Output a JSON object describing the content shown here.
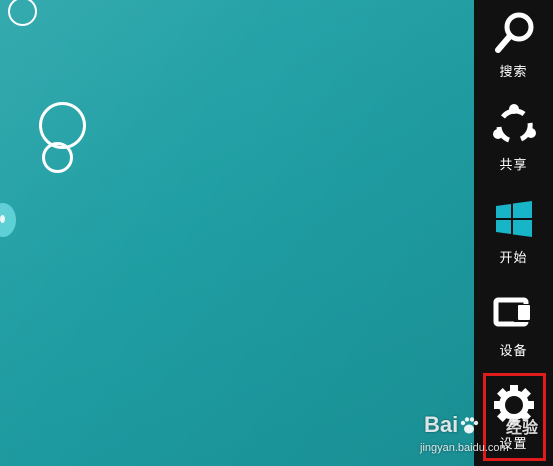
{
  "colors": {
    "desktop_background": "#1f9ea3",
    "charms_bar": "#111111",
    "start_tile": "#18b4c8",
    "highlight": "#e01b1b"
  },
  "charms": [
    {
      "id": "search",
      "label": "搜索",
      "icon": "search-icon"
    },
    {
      "id": "share",
      "label": "共享",
      "icon": "share-icon"
    },
    {
      "id": "start",
      "label": "开始",
      "icon": "windows-logo-icon"
    },
    {
      "id": "devices",
      "label": "设备",
      "icon": "devices-icon"
    },
    {
      "id": "settings",
      "label": "设置",
      "icon": "gear-icon"
    }
  ],
  "watermark": {
    "logo_left": "Bai",
    "logo_right": "经验",
    "url": "jingyan.baidu.com"
  }
}
